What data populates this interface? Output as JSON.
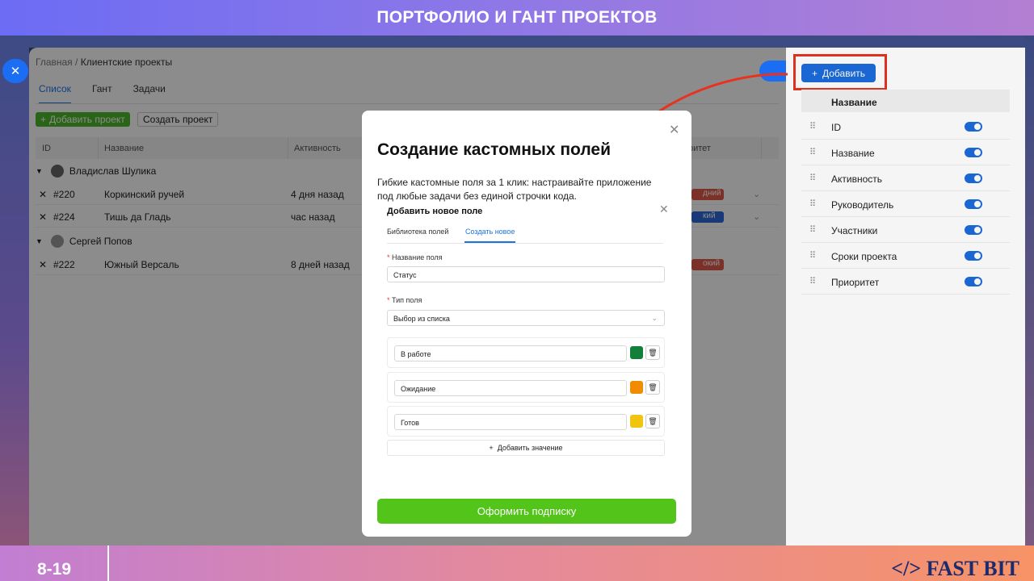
{
  "banner": {
    "title": "ПОРТФОЛИО И ГАНТ ПРОЕКТОВ",
    "page_number": "8-19",
    "brand": "</> FAST BIT"
  },
  "app": {
    "breadcrumb": {
      "home": "Главная",
      "sep": "/",
      "current": "Клиентские проекты"
    },
    "tabs": [
      {
        "label": "Список",
        "active": true
      },
      {
        "label": "Гант"
      },
      {
        "label": "Задачи"
      }
    ],
    "add_project_label": "Добавить проект",
    "create_project_label": "Создать проект",
    "columns": {
      "id": "ID",
      "name": "Название",
      "activity": "Активность",
      "priority": "ритет"
    },
    "groups": [
      {
        "owner": "Владислав Шулика",
        "rows": [
          {
            "id": "#220",
            "name": "Коркинский ручей",
            "activity": "4 дня назад",
            "priority": "дний",
            "color": "#e05a4a"
          },
          {
            "id": "#224",
            "name": "Тишь да Гладь",
            "activity": "час назад",
            "priority": "кий",
            "color": "#2f6bd8"
          }
        ]
      },
      {
        "owner": "Сергей Попов",
        "rows": [
          {
            "id": "#222",
            "name": "Южный Версаль",
            "activity": "8 дней назад",
            "priority": "окий",
            "color": "#e05a4a"
          }
        ]
      }
    ]
  },
  "panel": {
    "add_label": "Добавить",
    "header": "Название",
    "fields": [
      "ID",
      "Название",
      "Активность",
      "Руководитель",
      "Участники",
      "Сроки проекта",
      "Приоритет"
    ]
  },
  "modal": {
    "title": "Создание кастомных полей",
    "description": "Гибкие кастомные поля за 1 клик: настраивайте приложение под любые задачи без единой строчки кода.",
    "inner": {
      "title": "Добавить новое поле",
      "tabs": [
        "Библиотека полей",
        "Создать новое"
      ],
      "field_name_label": "Название поля",
      "field_name_value": "Статус",
      "field_type_label": "Тип поля",
      "field_type_value": "Выбор из списка",
      "options": [
        {
          "label": "В работе",
          "color": "#11803a"
        },
        {
          "label": "Ожидание",
          "color": "#f08c00"
        },
        {
          "label": "Готов",
          "color": "#f1c40f"
        }
      ],
      "add_value_label": "Добавить значение"
    },
    "subscribe_label": "Оформить подписку"
  }
}
